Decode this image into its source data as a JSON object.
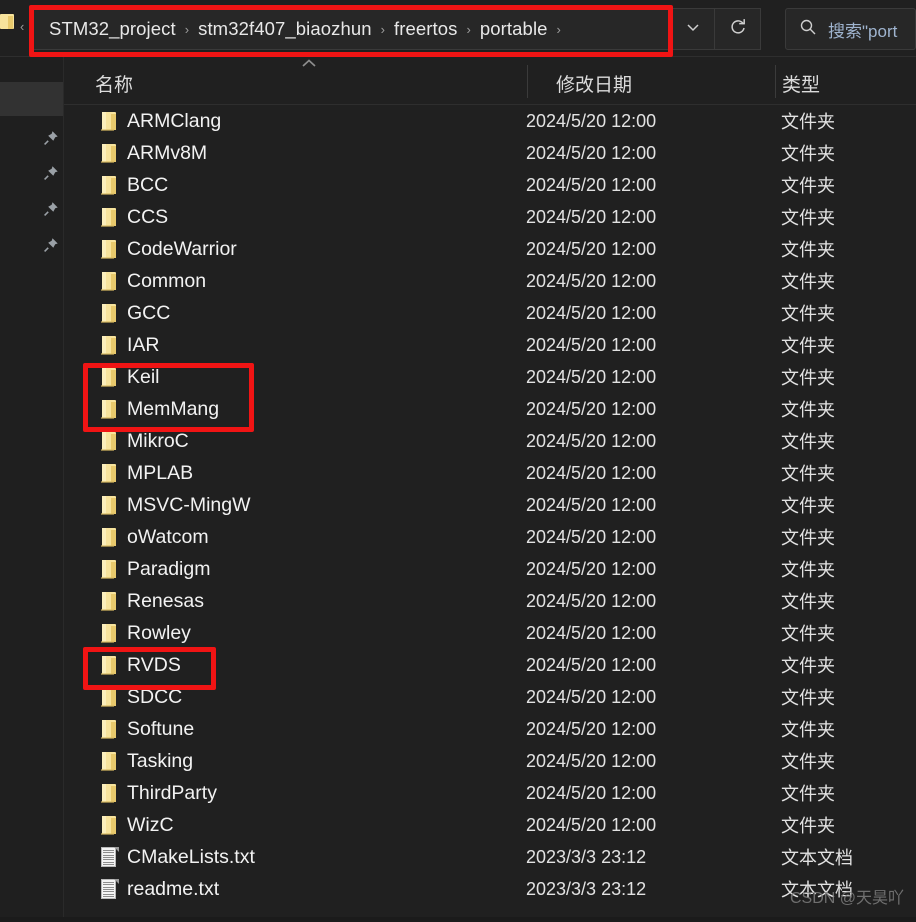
{
  "window": {
    "background_color": "#202020",
    "accent_highlight_color": "#f01414"
  },
  "address_bar": {
    "back_chevron": "‹",
    "breadcrumb": [
      "STM32_project",
      "stm32f407_biaozhun",
      "freertos",
      "portable"
    ],
    "separator": "›",
    "trailing_separator": "›",
    "dropdown_icon": "chevron-down-icon",
    "refresh_icon": "refresh-icon"
  },
  "search": {
    "icon": "search-icon",
    "placeholder": "搜索\"port"
  },
  "sidebar": {
    "pinned_items": [
      "pin-icon",
      "pin-icon",
      "pin-icon",
      "pin-icon"
    ],
    "selected_index": 0
  },
  "columns": {
    "name": "名称",
    "date_modified": "修改日期",
    "type": "类型",
    "sort_indicator": "^",
    "sort_column": "名称",
    "sort_direction": "ascending"
  },
  "files": [
    {
      "name": "ARMClang",
      "date": "2024/5/20 12:00",
      "type": "文件夹",
      "icon": "folder-icon"
    },
    {
      "name": "ARMv8M",
      "date": "2024/5/20 12:00",
      "type": "文件夹",
      "icon": "folder-icon"
    },
    {
      "name": "BCC",
      "date": "2024/5/20 12:00",
      "type": "文件夹",
      "icon": "folder-icon"
    },
    {
      "name": "CCS",
      "date": "2024/5/20 12:00",
      "type": "文件夹",
      "icon": "folder-icon"
    },
    {
      "name": "CodeWarrior",
      "date": "2024/5/20 12:00",
      "type": "文件夹",
      "icon": "folder-icon"
    },
    {
      "name": "Common",
      "date": "2024/5/20 12:00",
      "type": "文件夹",
      "icon": "folder-icon"
    },
    {
      "name": "GCC",
      "date": "2024/5/20 12:00",
      "type": "文件夹",
      "icon": "folder-icon"
    },
    {
      "name": "IAR",
      "date": "2024/5/20 12:00",
      "type": "文件夹",
      "icon": "folder-icon"
    },
    {
      "name": "Keil",
      "date": "2024/5/20 12:00",
      "type": "文件夹",
      "icon": "folder-icon"
    },
    {
      "name": "MemMang",
      "date": "2024/5/20 12:00",
      "type": "文件夹",
      "icon": "folder-icon"
    },
    {
      "name": "MikroC",
      "date": "2024/5/20 12:00",
      "type": "文件夹",
      "icon": "folder-icon"
    },
    {
      "name": "MPLAB",
      "date": "2024/5/20 12:00",
      "type": "文件夹",
      "icon": "folder-icon"
    },
    {
      "name": "MSVC-MingW",
      "date": "2024/5/20 12:00",
      "type": "文件夹",
      "icon": "folder-icon"
    },
    {
      "name": "oWatcom",
      "date": "2024/5/20 12:00",
      "type": "文件夹",
      "icon": "folder-icon"
    },
    {
      "name": "Paradigm",
      "date": "2024/5/20 12:00",
      "type": "文件夹",
      "icon": "folder-icon"
    },
    {
      "name": "Renesas",
      "date": "2024/5/20 12:00",
      "type": "文件夹",
      "icon": "folder-icon"
    },
    {
      "name": "Rowley",
      "date": "2024/5/20 12:00",
      "type": "文件夹",
      "icon": "folder-icon"
    },
    {
      "name": "RVDS",
      "date": "2024/5/20 12:00",
      "type": "文件夹",
      "icon": "folder-icon"
    },
    {
      "name": "SDCC",
      "date": "2024/5/20 12:00",
      "type": "文件夹",
      "icon": "folder-icon"
    },
    {
      "name": "Softune",
      "date": "2024/5/20 12:00",
      "type": "文件夹",
      "icon": "folder-icon"
    },
    {
      "name": "Tasking",
      "date": "2024/5/20 12:00",
      "type": "文件夹",
      "icon": "folder-icon"
    },
    {
      "name": "ThirdParty",
      "date": "2024/5/20 12:00",
      "type": "文件夹",
      "icon": "folder-icon"
    },
    {
      "name": "WizC",
      "date": "2024/5/20 12:00",
      "type": "文件夹",
      "icon": "folder-icon"
    },
    {
      "name": "CMakeLists.txt",
      "date": "2023/3/3 23:12",
      "type": "文本文档",
      "icon": "text-document-icon"
    },
    {
      "name": "readme.txt",
      "date": "2023/3/3 23:12",
      "type": "文本文档",
      "icon": "text-document-icon"
    }
  ],
  "annotations": [
    {
      "label": "address-bar-highlight",
      "target": "breadcrumb path"
    },
    {
      "label": "keil-memmang-highlight",
      "target": "Keil, MemMang"
    },
    {
      "label": "rvds-highlight",
      "target": "RVDS"
    }
  ],
  "watermark": {
    "text": "CSDN @天昊吖"
  }
}
